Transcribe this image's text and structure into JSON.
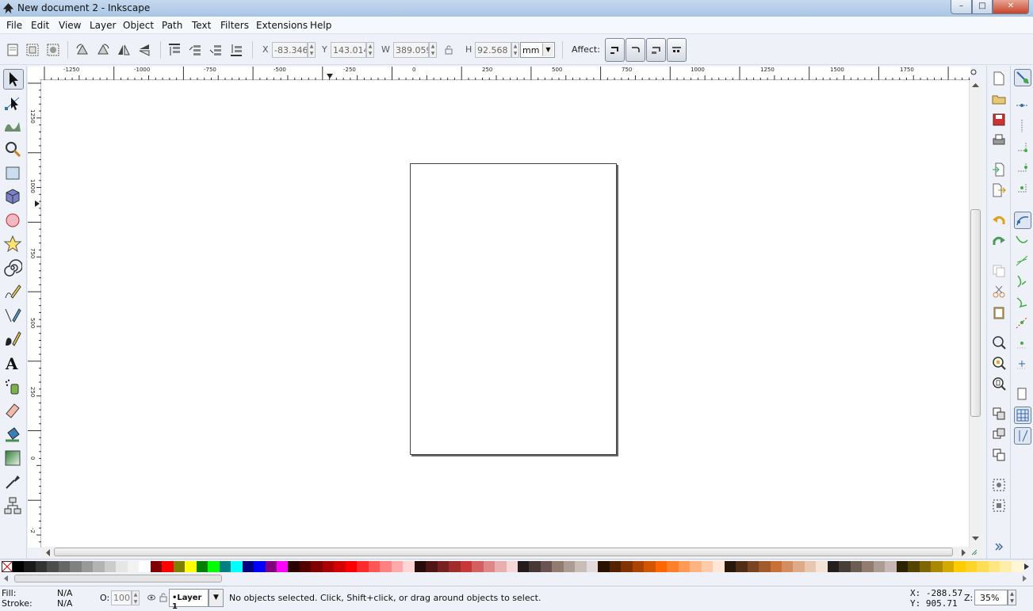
{
  "window": {
    "title": "New document 2 - Inkscape",
    "controls": {
      "minimize": "–",
      "maximize": "□",
      "close": "✕"
    }
  },
  "menu": [
    "File",
    "Edit",
    "View",
    "Layer",
    "Object",
    "Path",
    "Text",
    "Filters",
    "Extensions",
    "Help"
  ],
  "select_toolbar": {
    "x_label": "X",
    "x_value": "-83.346",
    "y_label": "Y",
    "y_value": "143.014",
    "w_label": "W",
    "w_value": "389.059",
    "h_label": "H",
    "h_value": "92.568",
    "unit": "mm",
    "affect_label": "Affect:"
  },
  "rulers": {
    "horizontal_labels": [
      "-1250",
      "-1000",
      "-750",
      "-500",
      "-250",
      "0",
      "250",
      "500",
      "750",
      "1000",
      "1250",
      "1500",
      "1750"
    ],
    "vertical_labels": [
      "1250",
      "1000",
      "750",
      "500",
      "250",
      "0",
      "-2"
    ]
  },
  "tools": [
    "selector-tool",
    "node-tool",
    "tweak-tool",
    "zoom-tool",
    "rectangle-tool",
    "3dbox-tool",
    "ellipse-tool",
    "star-tool",
    "spiral-tool",
    "pencil-tool",
    "pen-tool",
    "calligraphy-tool",
    "text-tool",
    "spray-tool",
    "eraser-tool",
    "paint-bucket-tool",
    "gradient-tool",
    "dropper-tool",
    "connector-tool"
  ],
  "palette_colors": [
    "#000000",
    "#1a1a1a",
    "#333333",
    "#4d4d4d",
    "#666666",
    "#808080",
    "#999999",
    "#b3b3b3",
    "#cccccc",
    "#e6e6e6",
    "#f2f2f2",
    "#ffffff",
    "#800000",
    "#ff0000",
    "#808000",
    "#ffff00",
    "#008000",
    "#00ff00",
    "#008080",
    "#00ffff",
    "#000080",
    "#0000ff",
    "#800080",
    "#ff00ff",
    "#2b0000",
    "#550000",
    "#800000",
    "#aa0000",
    "#d40000",
    "#ff0000",
    "#ff2a2a",
    "#ff5555",
    "#ff8080",
    "#ffaaaa",
    "#ffd5d5",
    "#280b0b",
    "#501616",
    "#782121",
    "#a02c2c",
    "#c83737",
    "#d35f5f",
    "#de8787",
    "#e9afaf",
    "#f4d7d7",
    "#241c1c",
    "#483737",
    "#6c5353",
    "#917c6f",
    "#ac9d93",
    "#c8beb7",
    "#e3dbdb",
    "#2b1100",
    "#552200",
    "#803300",
    "#aa4400",
    "#d45500",
    "#ff6600",
    "#ff7f2a",
    "#ff9955",
    "#ffb380",
    "#ffccaa",
    "#ffe6d5",
    "#28170b",
    "#502d16",
    "#784421",
    "#a05a2c",
    "#c87137",
    "#d38d5f",
    "#deaa87",
    "#e9c6af",
    "#f4e3d7",
    "#241f1c",
    "#483e37",
    "#6c5d53",
    "#917c6f",
    "#ac9d93",
    "#c8b7b7",
    "#2b2200",
    "#554400",
    "#806600",
    "#aa8800",
    "#d4aa00",
    "#ffcc00",
    "#ffd42a",
    "#ffdd55",
    "#ffe680",
    "#ffeeaa",
    "#fff6d5"
  ],
  "status": {
    "fill_label": "Fill:",
    "fill_value": "N/A",
    "stroke_label": "Stroke:",
    "stroke_value": "N/A",
    "opacity_label": "O:",
    "opacity_value": "100",
    "layer": "•Layer 1",
    "message": "No objects selected. Click, Shift+click, or drag around objects to select.",
    "x_coord": "X: -288.57",
    "y_coord": "Y:  905.71",
    "zoom_label": "Z:",
    "zoom_value": "35%"
  }
}
